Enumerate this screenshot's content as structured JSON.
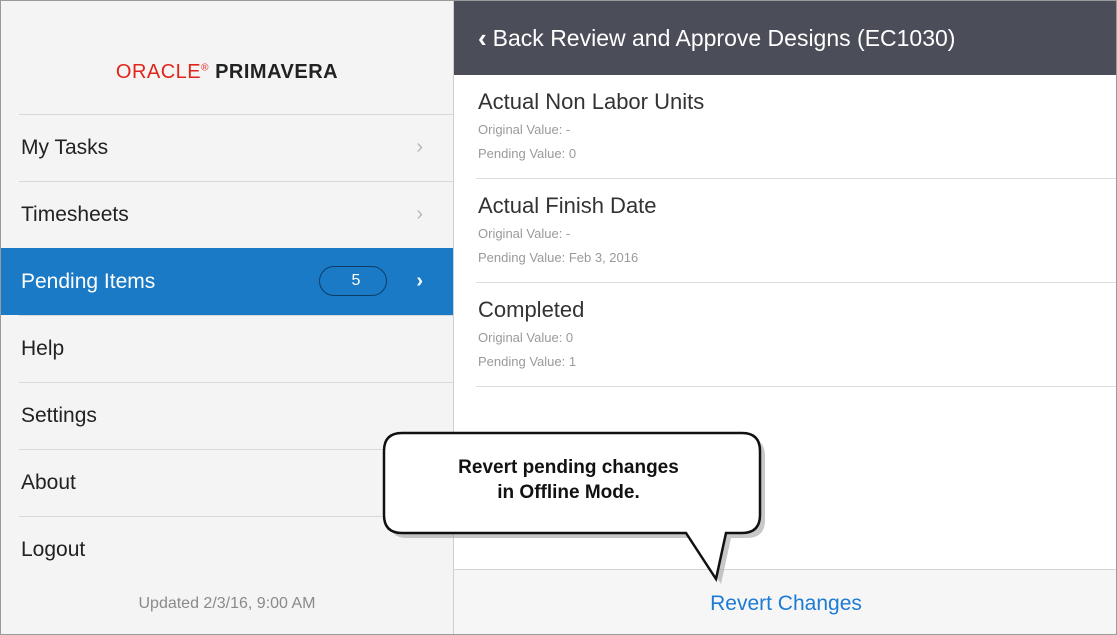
{
  "logo": {
    "oracle": "ORACLE",
    "reg": "®",
    "primavera": "PRIMAVERA"
  },
  "sidebar": {
    "items": [
      {
        "label": "My Tasks"
      },
      {
        "label": "Timesheets"
      },
      {
        "label": "Pending Items",
        "badge": "5",
        "active": true
      },
      {
        "label": "Help"
      },
      {
        "label": "Settings"
      },
      {
        "label": "About"
      },
      {
        "label": "Logout"
      }
    ],
    "updated": "Updated 2/3/16, 9:00 AM"
  },
  "header": {
    "back_icon": "chevron-left-icon",
    "title": "Back Review and Approve Designs (EC1030)"
  },
  "fields": [
    {
      "name": "Actual Non Labor Units",
      "original": "Original Value: -",
      "pending": "Pending Value: 0"
    },
    {
      "name": "Actual Finish Date",
      "original": "Original Value: -",
      "pending": "Pending Value: Feb 3, 2016"
    },
    {
      "name": "Completed",
      "original": "Original Value: 0",
      "pending": "Pending Value: 1"
    }
  ],
  "footer": {
    "revert_label": "Revert Changes"
  },
  "callout": {
    "line1": "Revert pending changes",
    "line2": "in Offline Mode."
  },
  "colors": {
    "accent": "#1a7ac6",
    "header_bg": "#4b4e58",
    "link": "#1c7bd4",
    "oracle_red": "#e0261b"
  }
}
